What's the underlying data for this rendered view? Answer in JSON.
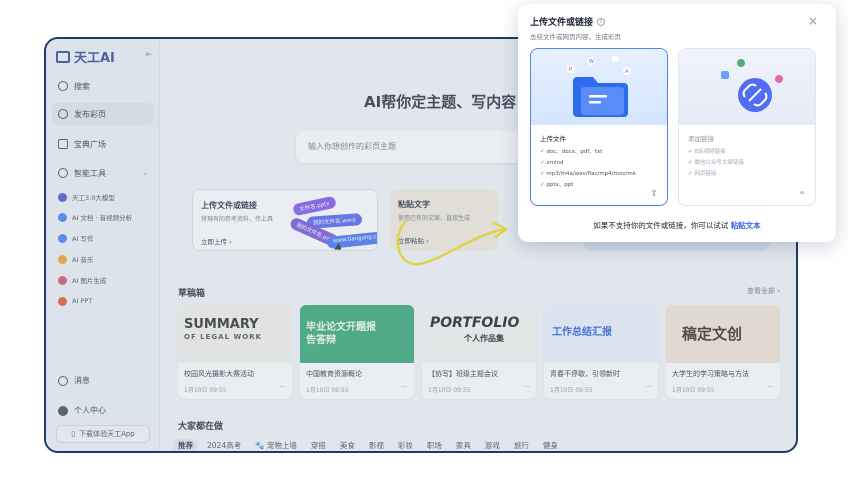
{
  "sidebar": {
    "brand": "天工AI",
    "collapse_icon": "⇤",
    "nav": [
      {
        "label": "搜索",
        "icon": "search-icon"
      },
      {
        "label": "发布彩页",
        "icon": "plus-circle-icon"
      },
      {
        "label": "宝典广场",
        "icon": "book-icon"
      },
      {
        "label": "智能工具",
        "icon": "tools-icon"
      }
    ],
    "tools": [
      {
        "label": "天工3.0大模型",
        "color": "#3a4ec9"
      },
      {
        "label": "AI 文档 · 音视频分析",
        "color": "#3478f6"
      },
      {
        "label": "AI 写作",
        "color": "#3478f6"
      },
      {
        "label": "AI 音乐",
        "color": "#f0a020"
      },
      {
        "label": "AI 图片生成",
        "color": "#d24a6a"
      },
      {
        "label": "AI PPT",
        "color": "#e44d26"
      }
    ],
    "messages": "消息",
    "profile": "个人中心",
    "download": "下载体验天工App"
  },
  "main": {
    "hero": "AI帮你定主题、写内容",
    "search_placeholder": "输入你想创作的彩页主题",
    "cards": [
      {
        "title": "上传文件或链接",
        "sub": "将現有的参考资料，传上具",
        "action": "立即上传 ›",
        "tags": [
          "文件名.pptx",
          "我的文件名.word",
          "我的文件名.pdf",
          "www.tiangong.cn"
        ]
      },
      {
        "title": "粘贴文字",
        "sub": "使用已有的文案，直接生成",
        "action": "立即粘贴 ›"
      }
    ],
    "drafts_title": "草稿箱",
    "drafts_more": "查看全部 ›",
    "drafts": [
      {
        "name": "校园风光摄影大赛活动",
        "date": "1月10日 09:55",
        "cover": "SUMMARY",
        "cover_sub": "OF LEGAL WORK"
      },
      {
        "name": "中国教育资源概论",
        "date": "1月10日 09:55",
        "cover": "毕业论文开题报告答辩"
      },
      {
        "name": "【协写】班级主题会议",
        "date": "1月10日 09:55",
        "cover": "PORTFOLIO",
        "cover_sub": "个人作品集"
      },
      {
        "name": "青春不停歇，引领新时",
        "date": "1月10日 09:55",
        "cover": "工作总结汇报"
      },
      {
        "name": "大学生的学习策略与方法",
        "date": "1月10日 09:55",
        "cover": "稿定文创"
      }
    ],
    "popular_title": "大家都在做",
    "tabs": [
      "推荐",
      "2024高考",
      "宠物上墙",
      "穿搭",
      "美食",
      "影视",
      "彩妆",
      "影视",
      "职场",
      "家具",
      "游戏",
      "旅行",
      "健身"
    ]
  },
  "popup": {
    "title": "上传文件或链接",
    "subtitle": "总结文件或网页内容，生成彩页",
    "close": "×",
    "upload": {
      "heading": "上传文件",
      "items": [
        "doc、docx、pdf、txt",
        "xmind",
        "mp3/m4a/wav/flac/mp4/mov/mk",
        "pptx、ppt"
      ]
    },
    "link": {
      "heading": "添加链接",
      "items": [
        "B站视频链接",
        "微信公众号文章链接",
        "网页链接"
      ]
    },
    "note_prefix": "如果不支持你的文件或链接，你可以试试",
    "note_link": "粘贴文本"
  }
}
